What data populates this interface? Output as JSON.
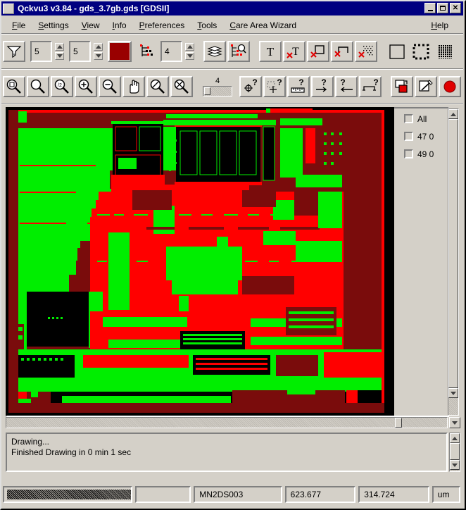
{
  "window": {
    "title": "Qckvu3 v3.84 - gds_3.7gb.gds [GDSII]",
    "titlebar_color": "#000080",
    "face_color": "#d4d0c8",
    "buttons": {
      "minimize": "minimize",
      "maximize": "maximize",
      "close": "✕"
    }
  },
  "menubar": {
    "items": [
      {
        "label": "File",
        "mnemonic": "F"
      },
      {
        "label": "Settings",
        "mnemonic": "S"
      },
      {
        "label": "View",
        "mnemonic": "V"
      },
      {
        "label": "Info",
        "mnemonic": "I"
      },
      {
        "label": "Preferences",
        "mnemonic": "P"
      },
      {
        "label": "Tools",
        "mnemonic": "T"
      },
      {
        "label": "Care Area Wizard",
        "mnemonic": "C"
      }
    ],
    "help": {
      "label": "Help",
      "mnemonic": "H"
    }
  },
  "toolbar_row_1": {
    "filter_button": "filter-funnel",
    "spinner_1": {
      "value": "5",
      "name": "depth-spinner-1"
    },
    "spinner_2": {
      "value": "5",
      "name": "depth-spinner-2"
    },
    "color_swatch": {
      "color": "#990000",
      "name": "layer-color-swatch"
    },
    "hierarchy_icon": "hierarchy-tree",
    "spinner_3": {
      "value": "4",
      "name": "level-spinner"
    },
    "layers_button": "layers-stack",
    "layer_browse_button": "layer-search",
    "text_button": "text-on",
    "text_off_button": "text-off",
    "shape_off_button": "shape-off",
    "path_off_button": "path-off",
    "fill_off_button": "fill-off",
    "fill_none_button": "fill-none",
    "fill_dashed_button": "fill-dashed",
    "fill_solid_button": "fill-solid"
  },
  "toolbar_row_2": {
    "zoom_fit_button": "zoom-fit",
    "zoom_button": "zoom",
    "zoom_half_button": "zoom-half",
    "zoom_in_button": "zoom-in",
    "zoom_out_button": "zoom-out",
    "pan_button": "pan-hand",
    "zoom_prev_button": "zoom-previous",
    "zoom_next_button": "zoom-next",
    "slider": {
      "label": "4",
      "name": "detail-slider"
    },
    "query_point_button": "query-point",
    "query_area_button": "query-area",
    "measure_button": "measure-ruler",
    "query_right_button": "query-arrow-right",
    "query_left_button": "query-arrow-left",
    "query_box_button": "query-box",
    "copy_button": "copy-layer",
    "edit_button": "edit-page",
    "record_button": "record-red"
  },
  "layers_panel": {
    "items": [
      {
        "label": "All",
        "checked": false
      },
      {
        "label": "47 0",
        "checked": false
      },
      {
        "label": "49 0",
        "checked": false
      }
    ]
  },
  "canvas": {
    "background": "#000000",
    "palette": {
      "bright_red": "#ff0000",
      "bright_green": "#00ee00",
      "dark_red": "#7a0c0c",
      "black": "#000000"
    }
  },
  "messages": {
    "lines": [
      "Drawing...",
      "Finished Drawing in 0 min 1 sec"
    ]
  },
  "statusbar": {
    "progress": "",
    "blank": "",
    "cell_name": "MN2DS003",
    "coord_x": "623.677",
    "coord_y": "314.724",
    "units": "um"
  }
}
